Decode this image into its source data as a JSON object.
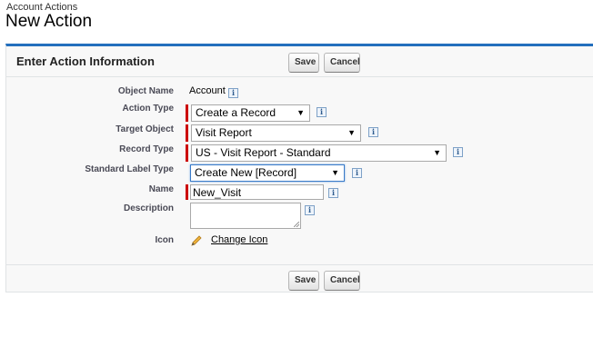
{
  "breadcrumb": "Account Actions",
  "page_title": "New Action",
  "panel": {
    "title": "Enter Action Information",
    "save_label": "Save",
    "cancel_label": "Cancel"
  },
  "fields": {
    "object_name": {
      "label": "Object Name",
      "value": "Account"
    },
    "action_type": {
      "label": "Action Type",
      "value": "Create a Record"
    },
    "target_object": {
      "label": "Target Object",
      "value": "Visit Report"
    },
    "record_type": {
      "label": "Record Type",
      "value": "US - Visit Report - Standard"
    },
    "standard_label_type": {
      "label": "Standard Label Type",
      "value": "Create New [Record]"
    },
    "name": {
      "label": "Name",
      "value": "New_Visit"
    },
    "description": {
      "label": "Description",
      "value": ""
    },
    "icon": {
      "label": "Icon",
      "link": "Change Icon"
    }
  },
  "footer": {
    "save_label": "Save",
    "cancel_label": "Cancel"
  },
  "icons": {
    "info": "info-icon",
    "pencil": "pencil-icon",
    "dropdown": "dropdown-arrow-icon"
  },
  "colors": {
    "panel_accent": "#236fbd",
    "required": "#cc0000"
  }
}
